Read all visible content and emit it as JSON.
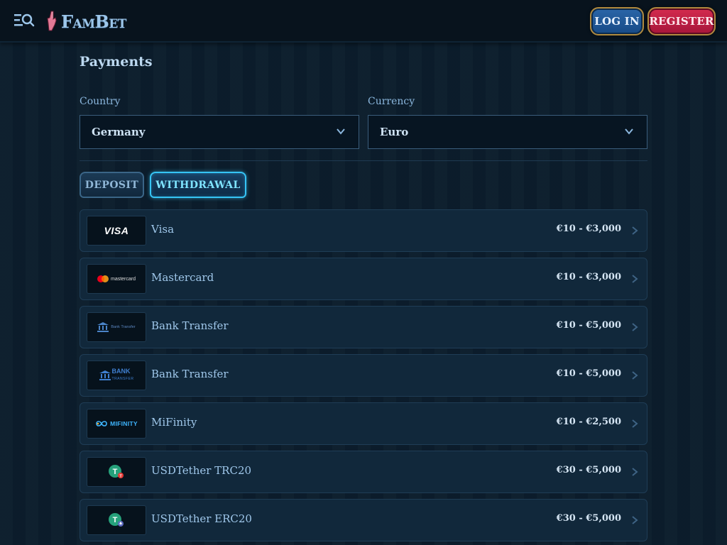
{
  "header": {
    "logo_text": "FamBet",
    "login_label": "LOG IN",
    "register_label": "REGISTER"
  },
  "page": {
    "title": "Payments"
  },
  "filters": {
    "country_label": "Country",
    "country_value": "Germany",
    "currency_label": "Currency",
    "currency_value": "Euro"
  },
  "tabs": [
    {
      "label": "DEPOSIT",
      "active": false
    },
    {
      "label": "WITHDRAWAL",
      "active": true
    }
  ],
  "methods": [
    {
      "name": "Visa",
      "range": "€10 - €3,000",
      "logo": "visa-logo",
      "logo_text": "VISA"
    },
    {
      "name": "Mastercard",
      "range": "€10 - €3,000",
      "logo": "mastercard-logo",
      "logo_text": "mastercard"
    },
    {
      "name": "Bank Transfer",
      "range": "€10 - €5,000",
      "logo": "bank-transfer-logo",
      "logo_text": "Bank Transfer"
    },
    {
      "name": "Bank Transfer",
      "range": "€10 - €5,000",
      "logo": "bank-transfer-logo-alt",
      "logo_text": "BANK",
      "logo_subtext": "TRANSFER"
    },
    {
      "name": "MiFinity",
      "range": "€10 - €2,500",
      "logo": "mifinity-logo",
      "logo_text": "MIFINITY"
    },
    {
      "name": "USDTether TRC20",
      "range": "€30 - €5,000",
      "logo": "tether-trc20-logo"
    },
    {
      "name": "USDTether ERC20",
      "range": "€30 - €5,000",
      "logo": "tether-erc20-logo"
    }
  ],
  "colors": {
    "background": "#0c1e2d",
    "header": "#08131d",
    "accent_cyan": "#36c4f5",
    "login_blue": "#1f5a9a",
    "register_red": "#c2213f",
    "text_blue": "#9cc6e8"
  }
}
